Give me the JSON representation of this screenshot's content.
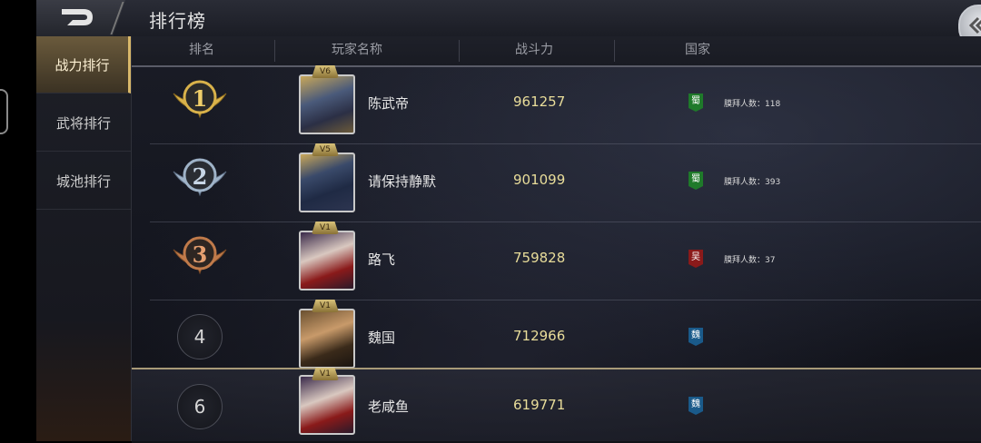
{
  "header": {
    "title": "排行榜"
  },
  "sidebar": {
    "items": [
      {
        "label": "战力排行",
        "active": true
      },
      {
        "label": "武将排行",
        "active": false
      },
      {
        "label": "城池排行",
        "active": false
      }
    ]
  },
  "columns": {
    "rank": "排名",
    "name": "玩家名称",
    "power": "战斗力",
    "country": "国家"
  },
  "rows": [
    {
      "rank": "1",
      "vip": "V6",
      "name": "陈武帝",
      "power": "961257",
      "country": "蜀",
      "country_color": "#1f7a2a",
      "worship": "膜拜人数：118"
    },
    {
      "rank": "2",
      "vip": "V5",
      "name": "请保持静默",
      "power": "901099",
      "country": "蜀",
      "country_color": "#1f7a2a",
      "worship": "膜拜人数：393"
    },
    {
      "rank": "3",
      "vip": "V1",
      "name": "路飞",
      "power": "759828",
      "country": "吴",
      "country_color": "#8a1a1a",
      "worship": "膜拜人数：37"
    },
    {
      "rank": "4",
      "vip": "V1",
      "name": "魏国",
      "power": "712966",
      "country": "魏",
      "country_color": "#1a5a8a",
      "worship": ""
    }
  ],
  "self_row": {
    "rank": "6",
    "vip": "V1",
    "name": "老咸鱼",
    "power": "619771",
    "country": "魏",
    "country_color": "#1a5a8a"
  },
  "colors": {
    "gold_medal": "#d9b24a",
    "silver_medal": "#9fb3c8",
    "bronze_medal": "#c07a4a",
    "power_text": "#e9dd9a"
  }
}
